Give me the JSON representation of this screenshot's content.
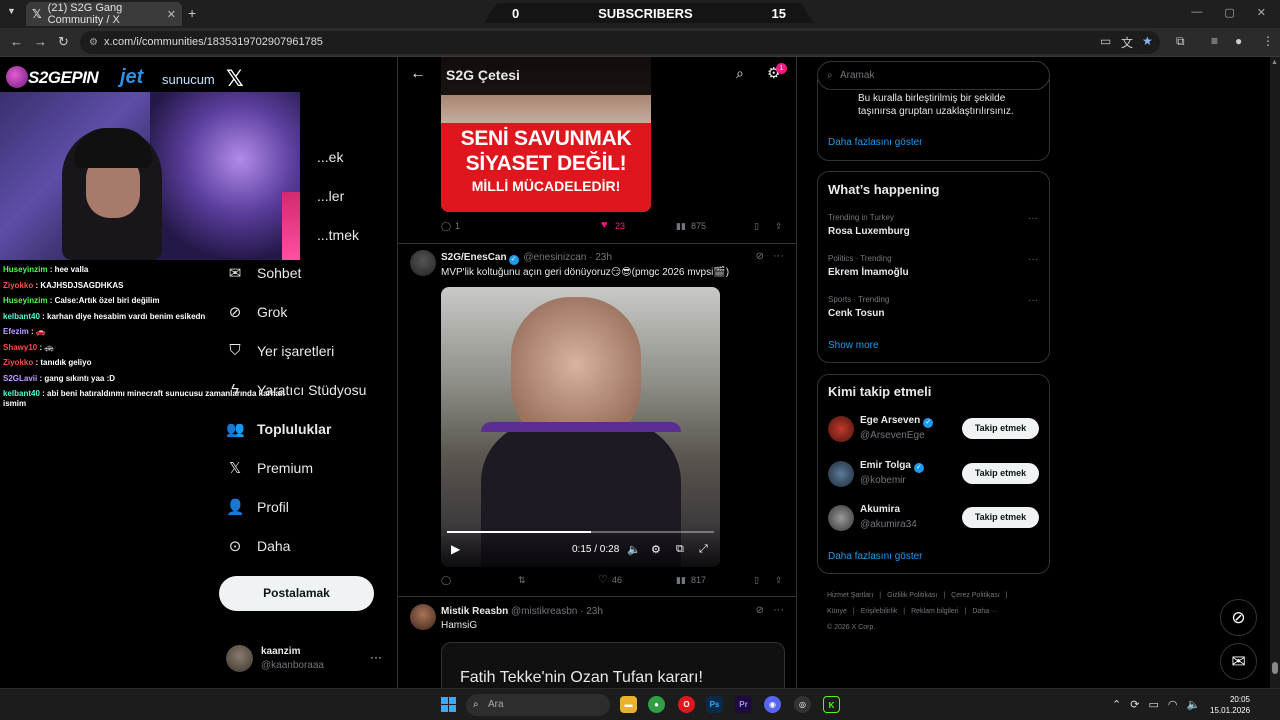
{
  "browser": {
    "tab_title": "(21) S2G Gang Community / X",
    "url": "x.com/i/communities/1835319702907961785",
    "new_tab": "+",
    "tab_close": "✕"
  },
  "overlay": {
    "sub_left": "0",
    "sub_label": "SUBSCRIBERS",
    "sub_right": "15",
    "logo1": "S2GEPIN",
    "logo2_a": "jet",
    "logo2_b": "sunucum"
  },
  "chat": [
    {
      "user": "Huseyinzim",
      "color": "#4cff4c",
      "msg": " : hee valla"
    },
    {
      "user": "Ziyokko",
      "color": "#ff4c4c",
      "msg": " : KAJHSDJSAGDHKAS"
    },
    {
      "user": "Huseyinzim",
      "color": "#4cff4c",
      "msg": " : Calse:Artık özel biri değilim"
    },
    {
      "user": "kelbant40",
      "color": "#4cffd2",
      "msg": " : karhan diye hesabim vardı benim esikedn"
    },
    {
      "user": "Efezim",
      "color": "#c49cff",
      "msg": " : 🚗"
    },
    {
      "user": "Shawy10",
      "color": "#ff4c4c",
      "msg": " : 🚓"
    },
    {
      "user": "Ziyokko",
      "color": "#ff4c4c",
      "msg": " : tanıdık geliyo"
    },
    {
      "user": "S2GLavii",
      "color": "#c49cff",
      "msg": " : gang sıkıntı yaa :D"
    },
    {
      "user": "kelbant40",
      "color": "#4cffd2",
      "msg": " : abi beni hatıraldınmı minecraft sunucusu zamanlarında karhan ismim"
    }
  ],
  "nav": {
    "items": [
      {
        "label": "...ek",
        "icon": "bell"
      },
      {
        "label": "...ler",
        "icon": "envelope"
      },
      {
        "label": "...tmek",
        "icon": "lists"
      },
      {
        "label": "Sohbet",
        "icon": "mail"
      },
      {
        "label": "Grok",
        "icon": "grok"
      },
      {
        "label": "Yer işaretleri",
        "icon": "bookmark"
      },
      {
        "label": "Yaratıcı Stüdyosu",
        "icon": "bolt"
      },
      {
        "label": "Topluluklar",
        "icon": "people"
      },
      {
        "label": "Premium",
        "icon": "x"
      },
      {
        "label": "Profil",
        "icon": "person"
      },
      {
        "label": "Daha",
        "icon": "more"
      }
    ],
    "post_label": "Postalamak",
    "me_name": "kaanzim",
    "me_handle": "@kaanboraaa",
    "me_more": "···"
  },
  "header": {
    "title": "S2G Çetesi",
    "badge": "1"
  },
  "tweet1": {
    "img_line1": "SENİ SAVUNMAK",
    "img_line2": "SİYASET DEĞİL!",
    "img_line3": "MİLLİ MÜCADELEDİR!",
    "replies": "1",
    "likes": "23",
    "views": "875"
  },
  "tweet2": {
    "name": "S2G/EnesCan",
    "handle": "@enesinizcan",
    "time": "· 23h",
    "text": "MVP'lik koltuğunu açın geri dönüyoruz😏😎(pmgc 2026 mvpsi🎬)",
    "video_time": "0:15 / 0:28",
    "video_progress": 0.54,
    "likes": "46",
    "views": "817"
  },
  "tweet3": {
    "name": "Mistik Reasbn",
    "handle": "@mistikreasbn",
    "time": "· 23h",
    "text": "HamsiG",
    "card_text": "Fatih Tekke'nin Ozan Tufan kararı!"
  },
  "right": {
    "search_placeholder": "Aramak",
    "rules_text": "Bu kuralla birleştirilmiş bir şekilde taşınırsa gruptan uzaklaştırılırsınız.",
    "rules_more": "Daha fazlasını göster",
    "happening_title": "What’s happening",
    "trends": [
      {
        "context": "Trending in Turkey",
        "name": "Rosa Luxemburg"
      },
      {
        "context": "Politics · Trending",
        "name": "Ekrem İmamoğlu"
      },
      {
        "context": "Sports · Trending",
        "name": "Cenk Tosun"
      }
    ],
    "trends_more": "Show more",
    "follow_title": "Kimi takip etmeli",
    "follow": [
      {
        "name": "Ege Arseven",
        "handle": "@ArsevenEge",
        "verified": true,
        "button": "Takip etmek"
      },
      {
        "name": "Emir Tolga",
        "handle": "@kobemir",
        "verified": true,
        "button": "Takip etmek"
      },
      {
        "name": "Akumira",
        "handle": "@akumira34",
        "verified": false,
        "button": "Takip etmek"
      }
    ],
    "follow_more": "Daha fazlasını göster",
    "footer": [
      "Hizmet Şartları",
      "|",
      "Gizlilik Politikası",
      "|",
      "Çerez Politikası",
      "|",
      "Künye",
      "|",
      "Erişilebilirlik",
      "|",
      "Reklam bilgileri",
      "|",
      "Daha ···",
      "© 2026 X Corp."
    ]
  },
  "taskbar": {
    "search": "Ara",
    "time": "20:05",
    "date": "15.01.2026"
  }
}
